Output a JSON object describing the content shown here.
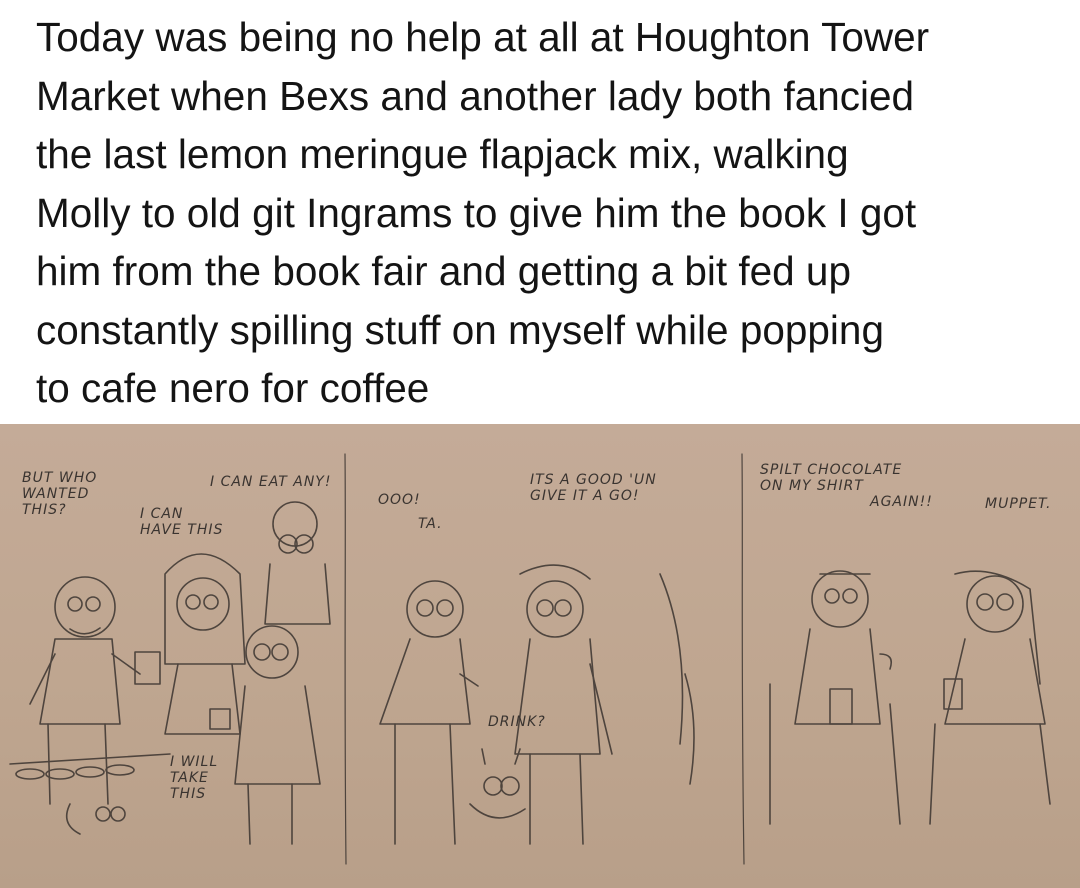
{
  "post": {
    "text_lines": [
      "Today was being no help at all at Houghton Tower",
      "Market when Bexs and another lady both fancied",
      "the last lemon meringue flapjack mix, walking",
      "Molly to old git Ingrams to give him the book I got",
      "him from the book fair and getting a bit fed up",
      "constantly spilling stuff on myself while popping",
      "to cafe nero for coffee"
    ]
  },
  "comic": {
    "panel1": {
      "bubble_1": "BUT WHO\nWANTED\nTHIS?",
      "bubble_2": "I CAN\nHAVE THIS",
      "bubble_3": "I CAN EAT ANY!",
      "bubble_4": "I WILL\nTAKE\nTHIS"
    },
    "panel2": {
      "bubble_1": "OOO!",
      "bubble_2": "TA.",
      "bubble_3": "ITS A GOOD 'UN\nGIVE IT A GO!",
      "bubble_4": "DRINK?"
    },
    "panel3": {
      "bubble_1": "SPILT CHOCOLATE\nON MY SHIRT",
      "bubble_2": "AGAIN!!",
      "bubble_3": "MUPPET."
    }
  }
}
